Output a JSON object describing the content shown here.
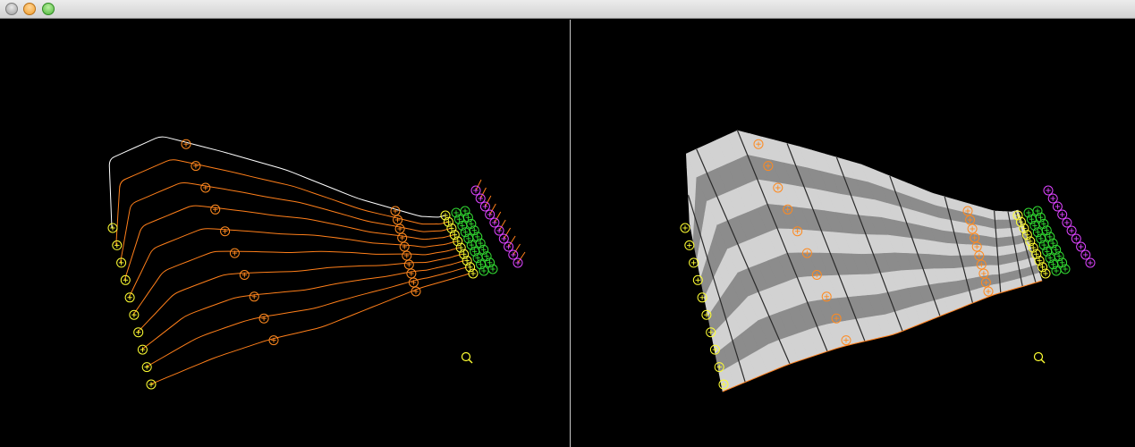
{
  "window": {
    "title": "",
    "controls": [
      "close",
      "minimize",
      "maximize"
    ]
  },
  "colors": {
    "background": "#000000",
    "curve_orange": "#ff7f1a",
    "curve_white": "#ffffff",
    "marker_yellow": "#ffff33",
    "marker_orange": "#ff8a1f",
    "marker_green": "#33dd33",
    "marker_magenta": "#dd44ff",
    "surface_light": "#d2d2d2",
    "surface_dark": "#8c8c8c"
  },
  "viewports": [
    {
      "name": "wireframe-view",
      "mode": "curves"
    },
    {
      "name": "surface-view",
      "mode": "shaded"
    }
  ],
  "icons": [
    "magnifier-icon",
    "control-point-icon"
  ]
}
